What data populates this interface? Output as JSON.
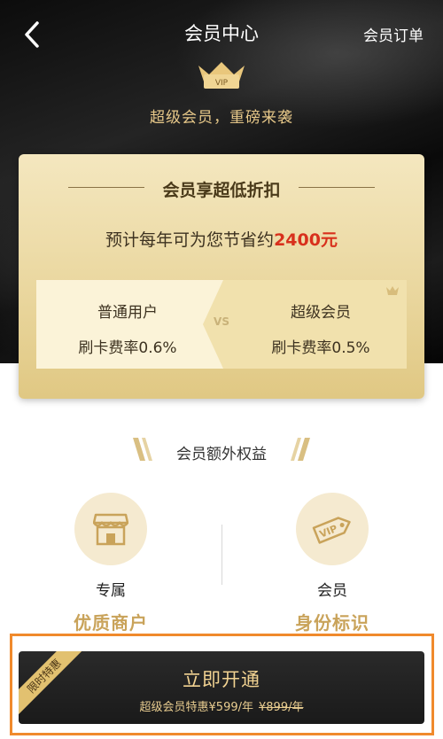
{
  "header": {
    "title": "会员中心",
    "orders_label": "会员订单"
  },
  "hero": {
    "badge_text": "VIP",
    "tagline": "超级会员，重磅来袭"
  },
  "discount_card": {
    "heading": "会员享超低折扣",
    "saving_prefix": "预计每年可为您节省约",
    "saving_amount": "2400元",
    "vs_label": "VS",
    "normal": {
      "label": "普通用户",
      "rate": "刷卡费率0.6%"
    },
    "super": {
      "label": "超级会员",
      "rate": "刷卡费率0.5%"
    }
  },
  "benefits": {
    "title": "会员额外权益",
    "items": [
      {
        "sub": "专属",
        "main": "优质商户",
        "icon": "store-icon"
      },
      {
        "sub": "会员",
        "main": "身份标识",
        "icon": "vip-tag-icon"
      }
    ],
    "tag_text": "VIP"
  },
  "cta": {
    "label": "立即开通",
    "price_text": "超级会员特惠¥599/年",
    "old_price": "¥899/年",
    "ribbon": "限时特惠"
  },
  "colors": {
    "gold": "#e7c889",
    "card": "#ead79f",
    "accent_red": "#d8301c",
    "highlight_border": "#f08a2c"
  }
}
